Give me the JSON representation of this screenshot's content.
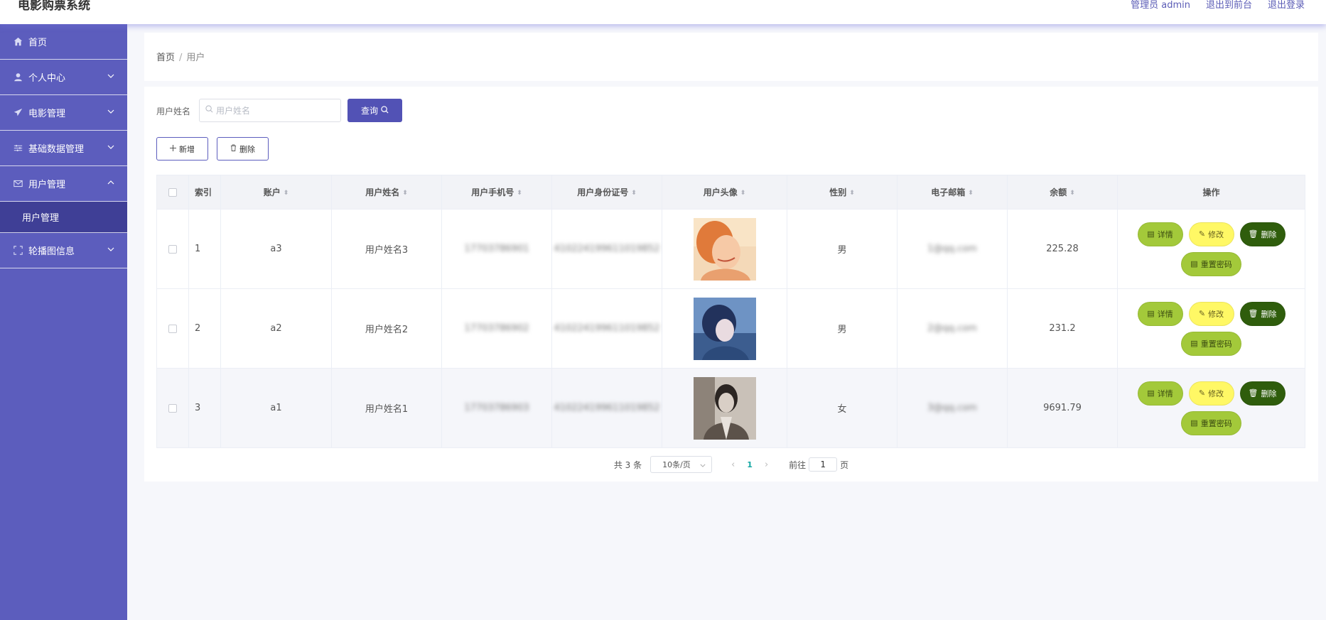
{
  "app": {
    "title": "电影购票系统"
  },
  "header": {
    "links": [
      "管理员 admin",
      "退出到前台",
      "退出登录"
    ]
  },
  "sidebar": {
    "items": [
      {
        "label": "首页",
        "icon": "home-icon"
      },
      {
        "label": "个人中心",
        "icon": "user-icon"
      },
      {
        "label": "电影管理",
        "icon": "send-icon"
      },
      {
        "label": "基础数据管理",
        "icon": "sliders-icon"
      },
      {
        "label": "用户管理",
        "icon": "mail-icon"
      },
      {
        "label": "轮播图信息",
        "icon": "fullscreen-icon"
      }
    ],
    "active_sub": "用户管理"
  },
  "breadcrumb": {
    "home": "首页",
    "separator": "/",
    "current": "用户"
  },
  "search": {
    "label": "用户姓名",
    "placeholder": "用户姓名",
    "button": "查询"
  },
  "actions": {
    "add": "新增",
    "delete": "删除"
  },
  "table": {
    "headers": [
      "索引",
      "账户",
      "用户姓名",
      "用户手机号",
      "用户身份证号",
      "用户头像",
      "性别",
      "电子邮箱",
      "余额",
      "操作"
    ],
    "rows": [
      {
        "index": "1",
        "account": "a3",
        "name": "用户姓名3",
        "phone": "17703786901",
        "idcard": "410224199611019852",
        "gender": "男",
        "email": "1@qq.com",
        "balance": "225.28"
      },
      {
        "index": "2",
        "account": "a2",
        "name": "用户姓名2",
        "phone": "17703786902",
        "idcard": "410224199611019852",
        "gender": "男",
        "email": "2@qq.com",
        "balance": "231.2"
      },
      {
        "index": "3",
        "account": "a1",
        "name": "用户姓名1",
        "phone": "17703786903",
        "idcard": "410224199611019852",
        "gender": "女",
        "email": "3@qq.com",
        "balance": "9691.79"
      }
    ],
    "row_buttons": {
      "detail": "详情",
      "edit": "修改",
      "delete": "删除",
      "reset": "重置密码"
    }
  },
  "pagination": {
    "total": "共 3 条",
    "page_size": "10条/页",
    "current": "1",
    "goto_label": "前往",
    "goto_value": "1",
    "page_suffix": "页"
  },
  "colors": {
    "sidebar": "#5c5dbd",
    "primary": "#5252b5",
    "detail": "#a3c93a",
    "edit": "#fff865",
    "delete": "#2f5d0c"
  }
}
